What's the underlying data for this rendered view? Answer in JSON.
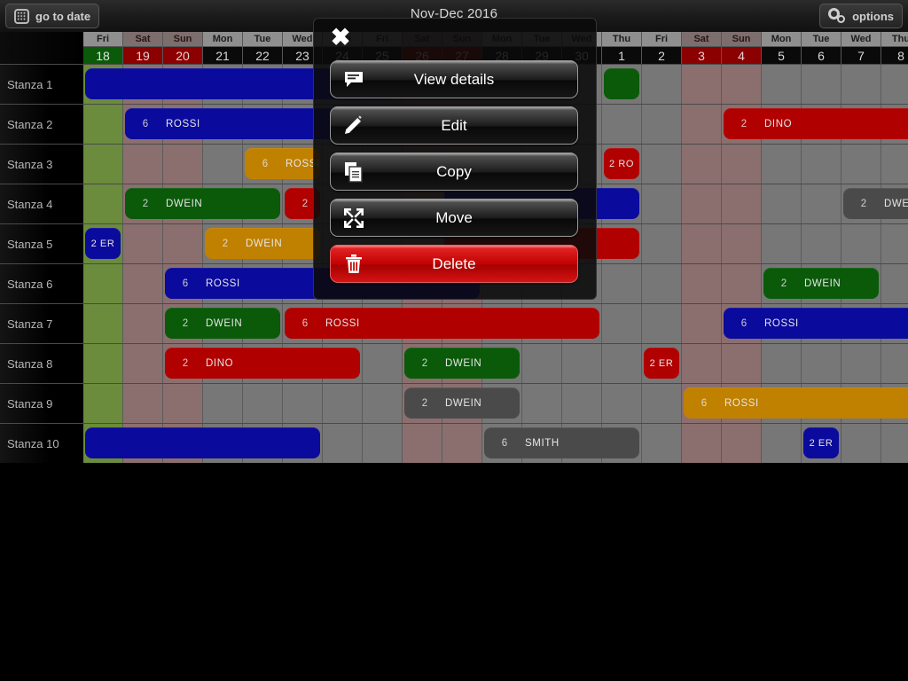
{
  "topbar": {
    "goto_label": "go to date",
    "goto_icon": "calendar-grid-icon",
    "title": "Nov-Dec 2016",
    "options_label": "options",
    "options_icon": "gear-icon"
  },
  "calendar": {
    "columns": [
      {
        "dow": "Fri",
        "date": "18",
        "type": "today"
      },
      {
        "dow": "Sat",
        "date": "19",
        "type": "weekend"
      },
      {
        "dow": "Sun",
        "date": "20",
        "type": "weekend"
      },
      {
        "dow": "Mon",
        "date": "21",
        "type": "normal"
      },
      {
        "dow": "Tue",
        "date": "22",
        "type": "normal"
      },
      {
        "dow": "Wed",
        "date": "23",
        "type": "normal"
      },
      {
        "dow": "Thu",
        "date": "24",
        "type": "normal"
      },
      {
        "dow": "Fri",
        "date": "25",
        "type": "normal"
      },
      {
        "dow": "Sat",
        "date": "26",
        "type": "weekend"
      },
      {
        "dow": "Sun",
        "date": "27",
        "type": "weekend"
      },
      {
        "dow": "Mon",
        "date": "28",
        "type": "normal"
      },
      {
        "dow": "Tue",
        "date": "29",
        "type": "normal"
      },
      {
        "dow": "Wed",
        "date": "30",
        "type": "normal"
      },
      {
        "dow": "Thu",
        "date": "1",
        "type": "normal"
      },
      {
        "dow": "Fri",
        "date": "2",
        "type": "normal"
      },
      {
        "dow": "Sat",
        "date": "3",
        "type": "weekend"
      },
      {
        "dow": "Sun",
        "date": "4",
        "type": "weekend"
      },
      {
        "dow": "Mon",
        "date": "5",
        "type": "normal"
      },
      {
        "dow": "Tue",
        "date": "6",
        "type": "normal"
      },
      {
        "dow": "Wed",
        "date": "7",
        "type": "normal"
      },
      {
        "dow": "Thu",
        "date": "8",
        "type": "normal"
      }
    ],
    "rooms": [
      "Stanza 1",
      "Stanza 2",
      "Stanza 3",
      "Stanza 4",
      "Stanza 5",
      "Stanza 6",
      "Stanza 7",
      "Stanza 8",
      "Stanza 9",
      "Stanza 10"
    ],
    "colors": {
      "blue": "#0a0a9c",
      "red": "#b00000",
      "green": "#0a5a0a",
      "orange": "#c08000",
      "gray": "#4a4a4a",
      "column_green": "#6b8b3d",
      "column_weekend": "#8b6f6f",
      "column_gray": "#777777"
    },
    "bookings": [
      {
        "room": 0,
        "start": 0,
        "span": 8,
        "pax": "",
        "name": "",
        "color": "blue",
        "label": ""
      },
      {
        "room": 0,
        "start": 13,
        "span": 1,
        "pax": "",
        "name": "",
        "color": "green",
        "label": ""
      },
      {
        "room": 1,
        "start": 1,
        "span": 9,
        "pax": "6",
        "name": "ROSSI",
        "color": "blue"
      },
      {
        "room": 1,
        "start": 16,
        "span": 5,
        "pax": "2",
        "name": "DINO",
        "color": "red"
      },
      {
        "room": 2,
        "start": 4,
        "span": 2,
        "pax": "6",
        "name": "ROSSI",
        "color": "orange"
      },
      {
        "room": 2,
        "start": 13,
        "span": 1,
        "pax": "",
        "name": "2 RO",
        "color": "red",
        "tiny": true
      },
      {
        "room": 3,
        "start": 1,
        "span": 4,
        "pax": "2",
        "name": "DWEIN",
        "color": "green"
      },
      {
        "room": 3,
        "start": 5,
        "span": 1,
        "pax": "2",
        "name": "",
        "color": "red"
      },
      {
        "room": 3,
        "start": 9,
        "span": 5,
        "pax": "",
        "name": "",
        "color": "blue"
      },
      {
        "room": 3,
        "start": 19,
        "span": 2,
        "pax": "2",
        "name": "DWEIN",
        "color": "gray"
      },
      {
        "room": 4,
        "start": 0,
        "span": 1,
        "pax": "",
        "name": "2 ER",
        "color": "blue",
        "tiny": true
      },
      {
        "room": 4,
        "start": 3,
        "span": 3,
        "pax": "2",
        "name": "DWEIN",
        "color": "orange"
      },
      {
        "room": 4,
        "start": 9,
        "span": 5,
        "pax": "",
        "name": "",
        "color": "red"
      },
      {
        "room": 5,
        "start": 2,
        "span": 8,
        "pax": "6",
        "name": "ROSSI",
        "color": "blue"
      },
      {
        "room": 5,
        "start": 17,
        "span": 3,
        "pax": "2",
        "name": "DWEIN",
        "color": "green"
      },
      {
        "room": 6,
        "start": 2,
        "span": 3,
        "pax": "2",
        "name": "DWEIN",
        "color": "green"
      },
      {
        "room": 6,
        "start": 5,
        "span": 8,
        "pax": "6",
        "name": "ROSSI",
        "color": "red"
      },
      {
        "room": 6,
        "start": 16,
        "span": 5,
        "pax": "6",
        "name": "ROSSI",
        "color": "blue"
      },
      {
        "room": 7,
        "start": 2,
        "span": 5,
        "pax": "2",
        "name": "DINO",
        "color": "red"
      },
      {
        "room": 7,
        "start": 8,
        "span": 3,
        "pax": "2",
        "name": "DWEIN",
        "color": "green"
      },
      {
        "room": 7,
        "start": 14,
        "span": 1,
        "pax": "",
        "name": "2 ER",
        "color": "red",
        "tiny": true
      },
      {
        "room": 8,
        "start": 8,
        "span": 3,
        "pax": "2",
        "name": "DWEIN",
        "color": "gray"
      },
      {
        "room": 8,
        "start": 15,
        "span": 6,
        "pax": "6",
        "name": "ROSSI",
        "color": "orange"
      },
      {
        "room": 9,
        "start": 0,
        "span": 6,
        "pax": "",
        "name": "",
        "color": "blue"
      },
      {
        "room": 9,
        "start": 10,
        "span": 4,
        "pax": "6",
        "name": "SMITH",
        "color": "gray"
      },
      {
        "room": 9,
        "start": 18,
        "span": 1,
        "pax": "",
        "name": "2 ER",
        "color": "blue",
        "tiny": true
      }
    ]
  },
  "modal": {
    "close_icon": "close-icon",
    "actions": [
      {
        "label": "View details",
        "icon": "comment-icon",
        "style": "normal"
      },
      {
        "label": "Edit",
        "icon": "pencil-icon",
        "style": "normal"
      },
      {
        "label": "Copy",
        "icon": "copy-icon",
        "style": "normal"
      },
      {
        "label": "Move",
        "icon": "move-arrows-icon",
        "style": "normal"
      },
      {
        "label": "Delete",
        "icon": "trash-icon",
        "style": "danger"
      }
    ]
  }
}
